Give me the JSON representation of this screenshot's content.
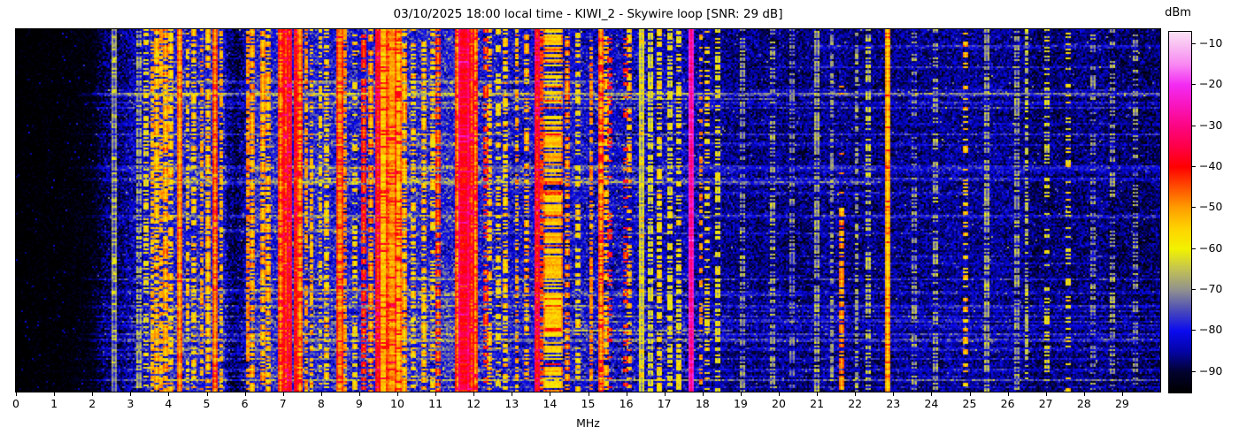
{
  "title": "03/10/2025 18:00 local time - KIWI_2 - Skywire loop [SNR: 29 dB]",
  "xlabel": "MHz",
  "colorbar": {
    "label": "dBm",
    "vmin": -95,
    "vmax": -7,
    "ticks": [
      -10,
      -20,
      -30,
      -40,
      -50,
      -60,
      -70,
      -80,
      -90
    ],
    "tick_labels": [
      "−10",
      "−20",
      "−30",
      "−40",
      "−50",
      "−60",
      "−70",
      "−80",
      "−90"
    ]
  },
  "x_ticks": [
    0,
    1,
    2,
    3,
    4,
    5,
    6,
    7,
    8,
    9,
    10,
    11,
    12,
    13,
    14,
    15,
    16,
    17,
    18,
    19,
    20,
    21,
    22,
    23,
    24,
    25,
    26,
    27,
    28,
    29
  ],
  "chart_data": {
    "type": "heatmap",
    "subtype": "radio-spectrogram-waterfall",
    "title": "03/10/2025 18:00 local time - KIWI_2 - Skywire loop [SNR: 29 dB]",
    "xlabel": "MHz",
    "ylabel": "",
    "x_range": [
      0,
      30
    ],
    "value_unit": "dBm",
    "value_range": [
      -95,
      -7
    ],
    "grid": false,
    "legend": "colorbar-right",
    "colormap_stops": [
      [
        -95,
        "#000000"
      ],
      [
        -90,
        "#02022e"
      ],
      [
        -85,
        "#0404a6"
      ],
      [
        -80,
        "#0a0af0"
      ],
      [
        -75,
        "#4a4ab9"
      ],
      [
        -70,
        "#90908f"
      ],
      [
        -65,
        "#c2c254"
      ],
      [
        -60,
        "#f2f200"
      ],
      [
        -55,
        "#ffd300"
      ],
      [
        -50,
        "#ff9e00"
      ],
      [
        -45,
        "#ff5000"
      ],
      [
        -40,
        "#ff0000"
      ],
      [
        -35,
        "#ff0048"
      ],
      [
        -30,
        "#fc0582"
      ],
      [
        -25,
        "#f815bd"
      ],
      [
        -20,
        "#f32af3"
      ],
      [
        -15,
        "#f887f2"
      ],
      [
        -10,
        "#f9c2f2"
      ],
      [
        -7,
        "#fbe2f7"
      ]
    ],
    "noise_floor_profile": [
      [
        0,
        -96
      ],
      [
        1,
        -95
      ],
      [
        1.8,
        -93
      ],
      [
        2.3,
        -89
      ],
      [
        2.8,
        -85
      ],
      [
        3.3,
        -81
      ],
      [
        3.6,
        -79
      ],
      [
        5.4,
        -79
      ],
      [
        5.55,
        -87
      ],
      [
        5.75,
        -89
      ],
      [
        5.95,
        -85
      ],
      [
        6.2,
        -79
      ],
      [
        12.4,
        -79
      ],
      [
        13,
        -81
      ],
      [
        16,
        -82
      ],
      [
        17.5,
        -83
      ],
      [
        18.3,
        -86
      ],
      [
        19.5,
        -88
      ],
      [
        20.4,
        -86
      ],
      [
        21.4,
        -86
      ],
      [
        22.4,
        -87
      ],
      [
        23,
        -86
      ],
      [
        26,
        -86
      ],
      [
        28,
        -87
      ],
      [
        30,
        -87
      ]
    ],
    "streaks": {
      "description": "horizontal time-row noise enhancements (lightning/wideband bursts)",
      "prob_bright": 0.05,
      "bright_boost_db": [
        8,
        16
      ],
      "prob_normal": 0.25,
      "normal_boost_db": [
        3,
        8.5
      ],
      "fade_in_start_mhz": 1.5,
      "fade_in_end_mhz": 2.4
    },
    "signals": [
      {
        "f": 2.55,
        "w": 0.03,
        "lv": -76,
        "cov": 0.8
      },
      {
        "f": 3.2,
        "w": 0.03,
        "lv": -72,
        "cov": 0.7
      },
      {
        "f": 3.38,
        "w": 0.04,
        "lv": -62,
        "cov": 0.45
      },
      {
        "f": 3.55,
        "w": 0.04,
        "lv": -58,
        "cov": 0.6
      },
      {
        "f": 3.65,
        "w": 0.05,
        "lv": -56,
        "cov": 0.7
      },
      {
        "f": 3.78,
        "w": 0.04,
        "lv": -58,
        "cov": 0.55
      },
      {
        "f": 3.9,
        "w": 0.05,
        "lv": -55,
        "cov": 0.75
      },
      {
        "f": 4.02,
        "w": 0.04,
        "lv": -58,
        "cov": 0.5
      },
      {
        "f": 4.26,
        "w": 0.07,
        "lv": -52,
        "cov": 0.97
      },
      {
        "f": 4.47,
        "w": 0.04,
        "lv": -60,
        "cov": 0.45
      },
      {
        "f": 4.65,
        "w": 0.04,
        "lv": -58,
        "cov": 0.5
      },
      {
        "f": 4.85,
        "w": 0.04,
        "lv": -57,
        "cov": 0.55
      },
      {
        "f": 5.0,
        "w": 0.05,
        "lv": -56,
        "cov": 0.6
      },
      {
        "f": 5.21,
        "w": 0.08,
        "lv": -50,
        "cov": 0.95
      },
      {
        "f": 5.36,
        "w": 0.04,
        "lv": -58,
        "cov": 0.5
      },
      {
        "f": 6.05,
        "w": 0.06,
        "lv": -55,
        "cov": 0.7
      },
      {
        "f": 6.18,
        "w": 0.05,
        "lv": -54,
        "cov": 0.7
      },
      {
        "f": 6.45,
        "w": 0.05,
        "lv": -55,
        "cov": 0.65
      },
      {
        "f": 6.58,
        "w": 0.05,
        "lv": -56,
        "cov": 0.6
      },
      {
        "f": 6.9,
        "w": 0.08,
        "lv": -50,
        "cov": 0.85
      },
      {
        "f": 7.05,
        "w": 0.1,
        "lv": -45,
        "cov": 0.9
      },
      {
        "f": 7.16,
        "w": 0.1,
        "lv": -42,
        "cov": 0.95
      },
      {
        "f": 7.3,
        "w": 0.08,
        "lv": -46,
        "cov": 0.9
      },
      {
        "f": 7.42,
        "w": 0.06,
        "lv": -52,
        "cov": 0.8
      },
      {
        "f": 7.58,
        "w": 0.04,
        "lv": -56,
        "cov": 0.6
      },
      {
        "f": 7.72,
        "w": 0.04,
        "lv": -58,
        "cov": 0.5
      },
      {
        "f": 7.95,
        "w": 0.04,
        "lv": -60,
        "cov": 0.4
      },
      {
        "f": 8.12,
        "w": 0.04,
        "lv": -58,
        "cov": 0.5
      },
      {
        "f": 8.45,
        "w": 0.12,
        "lv": -49,
        "cov": 0.85
      },
      {
        "f": 8.6,
        "w": 0.05,
        "lv": -55,
        "cov": 0.6
      },
      {
        "f": 8.85,
        "w": 0.04,
        "lv": -60,
        "cov": 0.4
      },
      {
        "f": 9.1,
        "w": 0.05,
        "lv": -45,
        "cov": 0.7
      },
      {
        "f": 9.28,
        "w": 0.06,
        "lv": -53,
        "cov": 0.7
      },
      {
        "f": 9.45,
        "w": 0.06,
        "lv": -44,
        "cov": 0.8
      },
      {
        "f": 9.6,
        "w": 0.25,
        "lv": -53,
        "cov": 0.9
      },
      {
        "f": 9.8,
        "w": 0.2,
        "lv": -50,
        "cov": 0.9
      },
      {
        "f": 10.0,
        "w": 0.15,
        "lv": -53,
        "cov": 0.85
      },
      {
        "f": 10.15,
        "w": 0.06,
        "lv": -55,
        "cov": 0.7
      },
      {
        "f": 10.4,
        "w": 0.04,
        "lv": -58,
        "cov": 0.5
      },
      {
        "f": 10.65,
        "w": 0.04,
        "lv": -57,
        "cov": 0.5
      },
      {
        "f": 10.9,
        "w": 0.04,
        "lv": -59,
        "cov": 0.45
      },
      {
        "f": 11.05,
        "w": 0.05,
        "lv": -48,
        "cov": 0.6
      },
      {
        "f": 11.55,
        "w": 0.06,
        "lv": -50,
        "cov": 0.85
      },
      {
        "f": 11.72,
        "w": 0.22,
        "lv": -38,
        "cov": 0.97
      },
      {
        "f": 11.9,
        "w": 0.08,
        "lv": -45,
        "cov": 0.9
      },
      {
        "f": 12.0,
        "w": 0.06,
        "lv": -50,
        "cov": 0.8
      },
      {
        "f": 12.27,
        "w": 0.04,
        "lv": -46,
        "cov": 0.5
      },
      {
        "f": 12.38,
        "w": 0.04,
        "lv": -57,
        "cov": 0.5
      },
      {
        "f": 12.6,
        "w": 0.04,
        "lv": -60,
        "cov": 0.4
      },
      {
        "f": 12.8,
        "w": 0.04,
        "lv": -58,
        "cov": 0.45
      },
      {
        "f": 13.1,
        "w": 0.04,
        "lv": -57,
        "cov": 0.5
      },
      {
        "f": 13.35,
        "w": 0.04,
        "lv": -55,
        "cov": 0.5
      },
      {
        "f": 13.62,
        "w": 0.08,
        "lv": -42,
        "cov": 0.9
      },
      {
        "f": 13.75,
        "w": 0.06,
        "lv": -50,
        "cov": 0.7
      },
      {
        "f": 14.05,
        "w": 0.45,
        "lv": -54,
        "cov": 0.7
      },
      {
        "f": 14.05,
        "w": 0.4,
        "lv": -45,
        "cov": 0.08
      },
      {
        "f": 14.42,
        "w": 0.05,
        "lv": -52,
        "cov": 0.5
      },
      {
        "f": 14.7,
        "w": 0.04,
        "lv": -60,
        "cov": 0.4
      },
      {
        "f": 15.05,
        "w": 0.05,
        "lv": -55,
        "cov": 0.6
      },
      {
        "f": 15.3,
        "w": 0.07,
        "lv": -52,
        "cov": 0.8
      },
      {
        "f": 15.45,
        "w": 0.04,
        "lv": -56,
        "cov": 0.5
      },
      {
        "f": 15.55,
        "w": 0.05,
        "lv": -45,
        "cov": 0.25
      },
      {
        "f": 15.95,
        "w": 0.04,
        "lv": -46,
        "cov": 0.3
      },
      {
        "f": 16.05,
        "w": 0.04,
        "lv": -56,
        "cov": 0.5
      },
      {
        "f": 16.35,
        "w": 0.03,
        "lv": -68,
        "cov": 0.8
      },
      {
        "f": 16.6,
        "w": 0.03,
        "lv": -66,
        "cov": 0.7
      },
      {
        "f": 16.85,
        "w": 0.03,
        "lv": -60,
        "cov": 0.55
      },
      {
        "f": 17.1,
        "w": 0.03,
        "lv": -64,
        "cov": 0.6
      },
      {
        "f": 17.35,
        "w": 0.03,
        "lv": -62,
        "cov": 0.5
      },
      {
        "f": 17.66,
        "w": 0.05,
        "lv": -30,
        "cov": 0.98
      },
      {
        "f": 17.92,
        "w": 0.04,
        "lv": -56,
        "cov": 0.6,
        "dash": [
          7,
          4
        ]
      },
      {
        "f": 18.1,
        "w": 0.03,
        "lv": -60,
        "cov": 0.4
      },
      {
        "f": 18.35,
        "w": 0.03,
        "lv": -64,
        "cov": 0.4
      },
      {
        "f": 19.0,
        "w": 0.03,
        "lv": -74,
        "cov": 0.5
      },
      {
        "f": 19.8,
        "w": 0.03,
        "lv": -72,
        "cov": 0.5
      },
      {
        "f": 20.3,
        "w": 0.03,
        "lv": -76,
        "cov": 0.55
      },
      {
        "f": 20.95,
        "w": 0.04,
        "lv": -73,
        "cov": 0.7
      },
      {
        "f": 21.35,
        "w": 0.03,
        "lv": -75,
        "cov": 0.5
      },
      {
        "f": 21.62,
        "w": 0.05,
        "lv": -53,
        "cov": 0.6,
        "bias": "bottom"
      },
      {
        "f": 22.0,
        "w": 0.03,
        "lv": -74,
        "cov": 0.4
      },
      {
        "f": 22.32,
        "w": 0.03,
        "lv": -69,
        "cov": 0.5
      },
      {
        "f": 22.8,
        "w": 0.04,
        "lv": -56,
        "cov": 0.92
      },
      {
        "f": 23.5,
        "w": 0.03,
        "lv": -74,
        "cov": 0.4
      },
      {
        "f": 24.05,
        "w": 0.03,
        "lv": -72,
        "cov": 0.4
      },
      {
        "f": 24.85,
        "w": 0.04,
        "lv": -57,
        "cov": 0.55,
        "dash": [
          6,
          3
        ]
      },
      {
        "f": 25.4,
        "w": 0.03,
        "lv": -72,
        "cov": 0.7
      },
      {
        "f": 26.2,
        "w": 0.03,
        "lv": -73,
        "cov": 0.6
      },
      {
        "f": 26.45,
        "w": 0.03,
        "lv": -71,
        "cov": 0.6
      },
      {
        "f": 27.0,
        "w": 0.03,
        "lv": -66,
        "cov": 0.3
      },
      {
        "f": 27.55,
        "w": 0.03,
        "lv": -62,
        "cov": 0.25
      },
      {
        "f": 28.2,
        "w": 0.03,
        "lv": -75,
        "cov": 0.45
      },
      {
        "f": 28.7,
        "w": 0.03,
        "lv": -73,
        "cov": 0.4
      },
      {
        "f": 29.3,
        "w": 0.03,
        "lv": -74,
        "cov": 0.4
      }
    ]
  }
}
